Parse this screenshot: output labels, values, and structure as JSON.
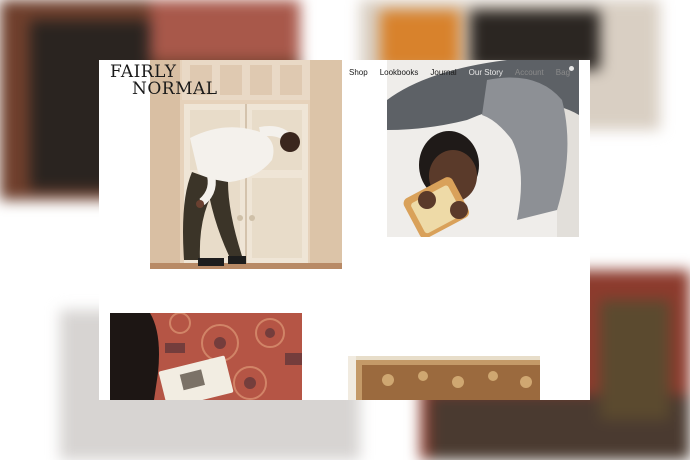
{
  "brand": {
    "logo_line1": "FAIRLY",
    "logo_line2": "NORMAL"
  },
  "nav": {
    "items": [
      "Shop",
      "Lookbooks",
      "Journal",
      "Our Story",
      "Account",
      "Bag"
    ]
  },
  "colors": {
    "text": "#1a1a1a",
    "muted_nav": "#8a8a8a",
    "rug_red": "#b8574a",
    "wall_cream": "#e7d3bd"
  },
  "images": [
    {
      "name": "man-bending-backwards-photo"
    },
    {
      "name": "man-holding-book-photo"
    },
    {
      "name": "person-reading-on-rug-photo"
    },
    {
      "name": "ornate-frame-photo"
    }
  ]
}
